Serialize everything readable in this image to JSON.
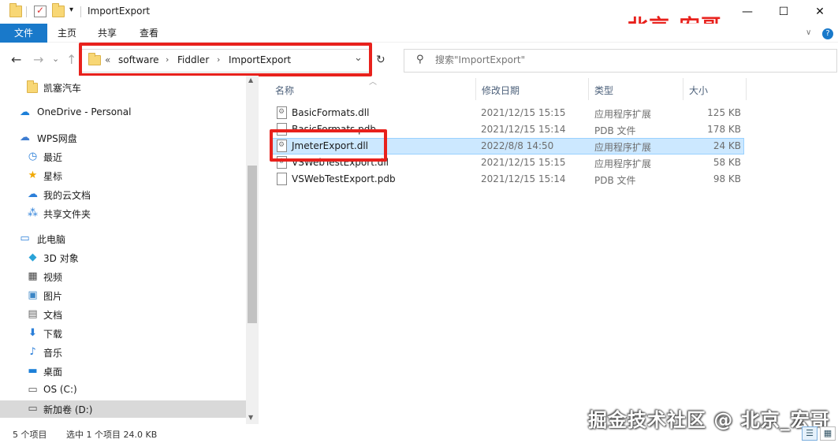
{
  "window": {
    "title": "ImportExport",
    "minimize": "—",
    "maximize": "☐",
    "close": "✕"
  },
  "watermark": {
    "top_right": "北京-宏哥",
    "bottom_right": "掘金技术社区 @ 北京_宏哥"
  },
  "ribbon": {
    "file": "文件",
    "tabs": [
      "主页",
      "共享",
      "查看"
    ],
    "help": "?",
    "expand": "∨"
  },
  "address": {
    "overflow": "«",
    "crumbs": [
      "software",
      "Fiddler",
      "ImportExport"
    ],
    "sep": "›",
    "dropdown": "⌄",
    "refresh": "↻"
  },
  "search": {
    "placeholder": "搜索\"ImportExport\""
  },
  "nav": {
    "back": "←",
    "forward": "→",
    "recent": "⌄",
    "up": "↑"
  },
  "sidebar": {
    "items": [
      {
        "label": "凯塞汽车",
        "icon": "folder-icon"
      },
      {
        "label": "OneDrive - Personal",
        "icon": "cloud-icon"
      },
      {
        "label": "WPS网盘",
        "icon": "wps-cloud-icon"
      },
      {
        "label": "最近",
        "icon": "clock-icon"
      },
      {
        "label": "星标",
        "icon": "star-icon"
      },
      {
        "label": "我的云文档",
        "icon": "cloud-doc-icon"
      },
      {
        "label": "共享文件夹",
        "icon": "share-icon"
      },
      {
        "label": "此电脑",
        "icon": "computer-icon"
      },
      {
        "label": "3D 对象",
        "icon": "cube-icon"
      },
      {
        "label": "视频",
        "icon": "video-icon"
      },
      {
        "label": "图片",
        "icon": "picture-icon"
      },
      {
        "label": "文档",
        "icon": "document-icon"
      },
      {
        "label": "下载",
        "icon": "download-icon"
      },
      {
        "label": "音乐",
        "icon": "music-icon"
      },
      {
        "label": "桌面",
        "icon": "desktop-icon"
      },
      {
        "label": "OS (C:)",
        "icon": "drive-icon"
      },
      {
        "label": "新加卷 (D:)",
        "icon": "drive-icon"
      }
    ]
  },
  "columns": {
    "name": "名称",
    "modified": "修改日期",
    "type": "类型",
    "size": "大小"
  },
  "files": [
    {
      "name": "BasicFormats.dll",
      "modified": "2021/12/15 15:15",
      "type": "应用程序扩展",
      "size": "125 KB"
    },
    {
      "name": "BasicFormats.pdb",
      "modified": "2021/12/15 15:14",
      "type": "PDB 文件",
      "size": "178 KB"
    },
    {
      "name": "JmeterExport.dll",
      "modified": "2022/8/8 14:50",
      "type": "应用程序扩展",
      "size": "24 KB"
    },
    {
      "name": "VSWebTestExport.dll",
      "modified": "2021/12/15 15:15",
      "type": "应用程序扩展",
      "size": "58 KB"
    },
    {
      "name": "VSWebTestExport.pdb",
      "modified": "2021/12/15 15:14",
      "type": "PDB 文件",
      "size": "98 KB"
    }
  ],
  "status": {
    "count": "5 个项目",
    "selected": "选中 1 个项目  24.0 KB"
  },
  "colors": {
    "accent": "#1979ca",
    "highlight_red": "#e8211c",
    "selection": "#cce8ff"
  }
}
